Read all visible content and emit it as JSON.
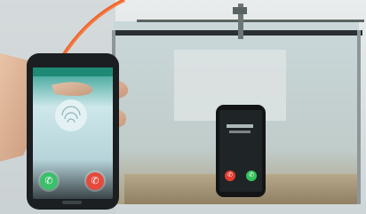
{
  "scene": {
    "description_icons": [
      "water-tank",
      "hand-holding-phone",
      "submerged-phone",
      "orange-cable"
    ]
  },
  "android_phone": {
    "screen_icons": [
      "fingerprint-avatar-icon",
      "accept-call-icon",
      "decline-call-icon"
    ],
    "accept_glyph": "✆",
    "decline_glyph": "✆"
  },
  "iphone": {
    "screen_icons": [
      "decline-call-icon",
      "accept-call-icon"
    ],
    "accept_glyph": "✆",
    "decline_glyph": "✆"
  },
  "colors": {
    "accept": "#3ac06a",
    "decline": "#e64a3c",
    "cable": "#f0652c",
    "tank_frame": "#2a3034"
  }
}
